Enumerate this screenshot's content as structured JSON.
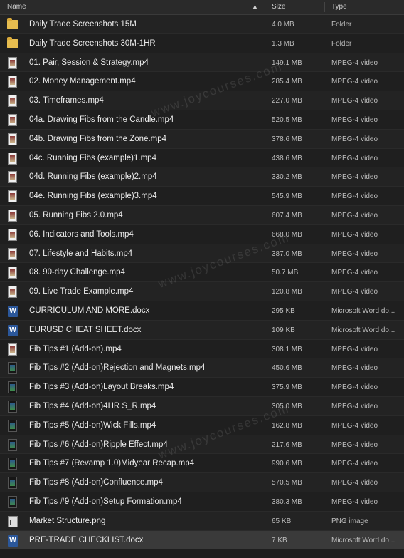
{
  "header": {
    "name": "Name",
    "size": "Size",
    "type": "Type",
    "sort_indicator": "▲"
  },
  "files": [
    {
      "name": "Daily Trade Screenshots 15M",
      "size": "4.0 MB",
      "type": "Folder",
      "icon": "folder-icon"
    },
    {
      "name": "Daily Trade Screenshots 30M-1HR",
      "size": "1.3 MB",
      "type": "Folder",
      "icon": "folder-icon"
    },
    {
      "name": "01. Pair, Session & Strategy.mp4",
      "size": "149.1 MB",
      "type": "MPEG-4 video",
      "icon": "video-file-icon"
    },
    {
      "name": "02. Money Management.mp4",
      "size": "285.4 MB",
      "type": "MPEG-4 video",
      "icon": "video-file-icon"
    },
    {
      "name": "03. Timeframes.mp4",
      "size": "227.0 MB",
      "type": "MPEG-4 video",
      "icon": "video-file-icon"
    },
    {
      "name": "04a. Drawing Fibs from the Candle.mp4",
      "size": "520.5 MB",
      "type": "MPEG-4 video",
      "icon": "video-file-icon"
    },
    {
      "name": "04b. Drawing Fibs from the Zone.mp4",
      "size": "378.6 MB",
      "type": "MPEG-4 video",
      "icon": "video-file-icon"
    },
    {
      "name": "04c. Running Fibs (example)1.mp4",
      "size": "438.6 MB",
      "type": "MPEG-4 video",
      "icon": "video-file-icon"
    },
    {
      "name": "04d. Running Fibs (example)2.mp4",
      "size": "330.2 MB",
      "type": "MPEG-4 video",
      "icon": "video-file-icon"
    },
    {
      "name": "04e. Running Fibs (example)3.mp4",
      "size": "545.9 MB",
      "type": "MPEG-4 video",
      "icon": "video-file-icon"
    },
    {
      "name": "05. Running Fibs 2.0.mp4",
      "size": "607.4 MB",
      "type": "MPEG-4 video",
      "icon": "video-file-icon"
    },
    {
      "name": "06. Indicators and Tools.mp4",
      "size": "668.0 MB",
      "type": "MPEG-4 video",
      "icon": "video-file-icon"
    },
    {
      "name": "07. Lifestyle and Habits.mp4",
      "size": "387.0 MB",
      "type": "MPEG-4 video",
      "icon": "video-file-icon"
    },
    {
      "name": "08. 90-day Challenge.mp4",
      "size": "50.7 MB",
      "type": "MPEG-4 video",
      "icon": "video-file-icon"
    },
    {
      "name": "09. Live Trade Example.mp4",
      "size": "120.8 MB",
      "type": "MPEG-4 video",
      "icon": "video-file-icon"
    },
    {
      "name": "CURRICULUM AND MORE.docx",
      "size": "295 KB",
      "type": "Microsoft Word do...",
      "icon": "word-doc-icon"
    },
    {
      "name": "EURUSD CHEAT SHEET.docx",
      "size": "109 KB",
      "type": "Microsoft Word do...",
      "icon": "word-doc-icon"
    },
    {
      "name": "Fib Tips #1 (Add-on).mp4",
      "size": "308.1 MB",
      "type": "MPEG-4 video",
      "icon": "video-file-icon"
    },
    {
      "name": "Fib Tips #2 (Add-on)Rejection and Magnets.mp4",
      "size": "450.6 MB",
      "type": "MPEG-4 video",
      "icon": "video-file-icon-dark"
    },
    {
      "name": "Fib Tips #3 (Add-on)Layout Breaks.mp4",
      "size": "375.9 MB",
      "type": "MPEG-4 video",
      "icon": "video-file-icon-dark"
    },
    {
      "name": "Fib Tips #4 (Add-on)4HR S_R.mp4",
      "size": "305.0 MB",
      "type": "MPEG-4 video",
      "icon": "video-file-icon-dark"
    },
    {
      "name": "Fib Tips #5 (Add-on)Wick Fills.mp4",
      "size": "162.8 MB",
      "type": "MPEG-4 video",
      "icon": "video-file-icon-dark"
    },
    {
      "name": "Fib Tips #6 (Add-on)Ripple Effect.mp4",
      "size": "217.6 MB",
      "type": "MPEG-4 video",
      "icon": "video-file-icon-dark"
    },
    {
      "name": "Fib Tips #7 (Revamp 1.0)Midyear Recap.mp4",
      "size": "990.6 MB",
      "type": "MPEG-4 video",
      "icon": "video-file-icon-dark"
    },
    {
      "name": "Fib Tips #8 (Add-on)Confluence.mp4",
      "size": "570.5 MB",
      "type": "MPEG-4 video",
      "icon": "video-file-icon-dark"
    },
    {
      "name": "Fib Tips #9 (Add-on)Setup Formation.mp4",
      "size": "380.3 MB",
      "type": "MPEG-4 video",
      "icon": "video-file-icon-dark"
    },
    {
      "name": "Market Structure.png",
      "size": "65 KB",
      "type": "PNG image",
      "icon": "image-file-icon"
    },
    {
      "name": "PRE-TRADE CHECKLIST.docx",
      "size": "7 KB",
      "type": "Microsoft Word do...",
      "icon": "word-doc-icon",
      "selected": true
    }
  ],
  "watermark": "www.joycourses.com",
  "word_icon_letter": "W"
}
